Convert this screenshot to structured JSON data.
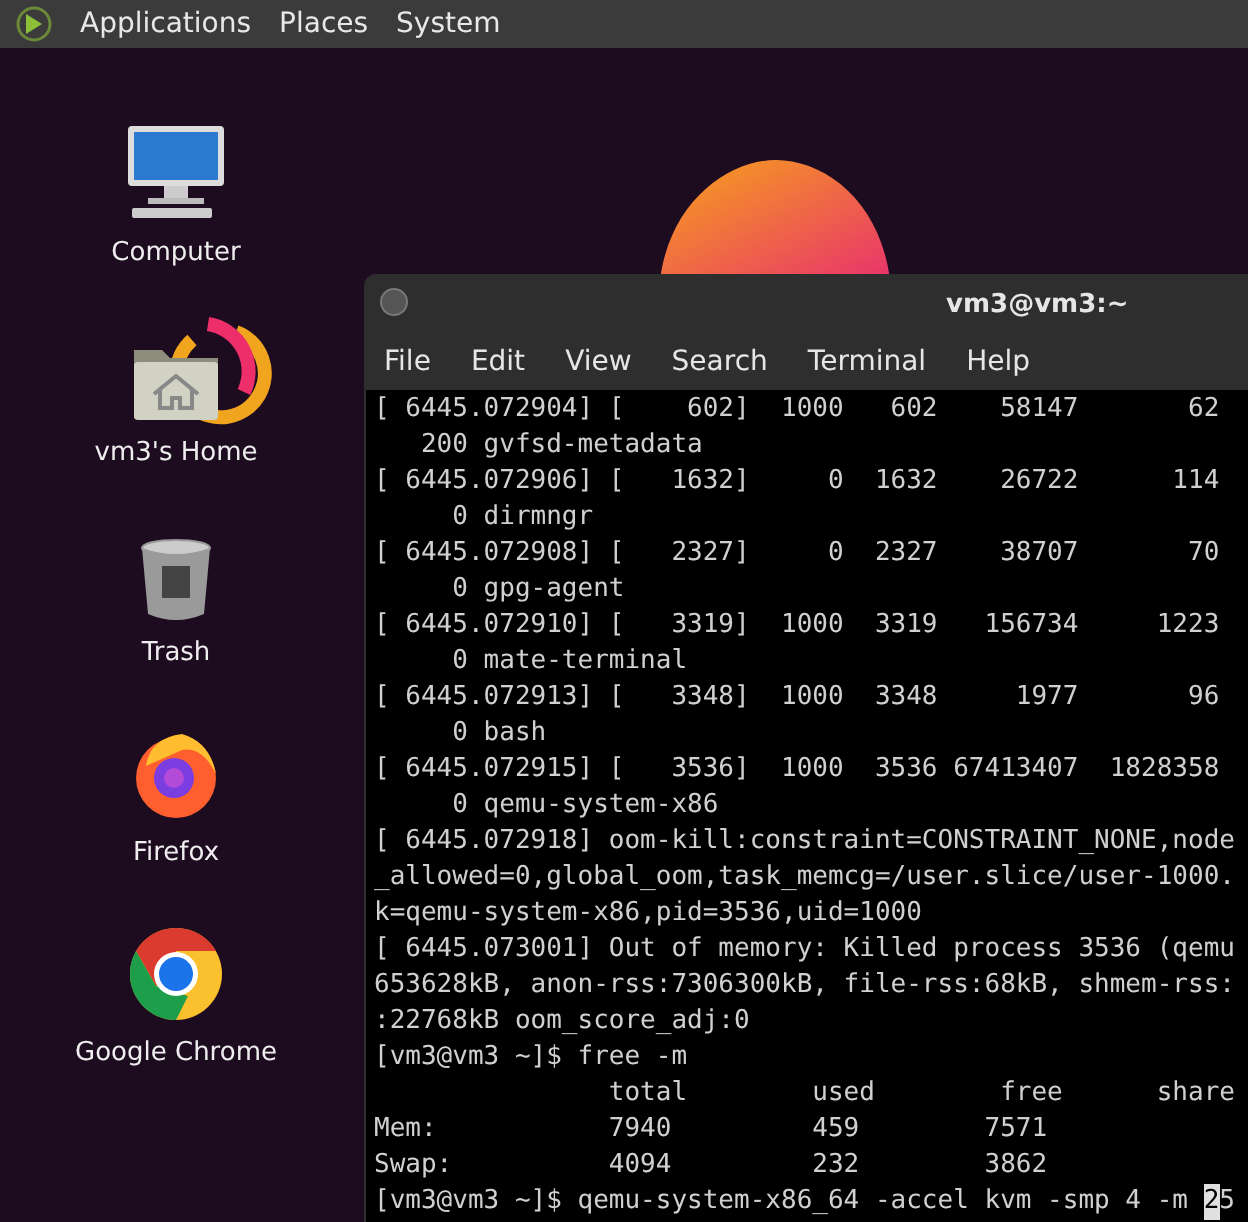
{
  "panel": {
    "menus": [
      "Applications",
      "Places",
      "System"
    ]
  },
  "desktop_icons": [
    {
      "kind": "computer",
      "label": "Computer"
    },
    {
      "kind": "home",
      "label": "vm3's Home"
    },
    {
      "kind": "trash",
      "label": "Trash"
    },
    {
      "kind": "firefox",
      "label": "Firefox"
    },
    {
      "kind": "chrome",
      "label": "Google Chrome"
    }
  ],
  "terminal": {
    "title": "vm3@vm3:~",
    "menu": [
      "File",
      "Edit",
      "View",
      "Search",
      "Terminal",
      "Help"
    ],
    "lines": [
      "[ 6445.072904] [    602]  1000   602    58147       62",
      "   200 gvfsd-metadata",
      "[ 6445.072906] [   1632]     0  1632    26722      114",
      "     0 dirmngr",
      "[ 6445.072908] [   2327]     0  2327    38707       70",
      "     0 gpg-agent",
      "[ 6445.072910] [   3319]  1000  3319   156734     1223",
      "     0 mate-terminal",
      "[ 6445.072913] [   3348]  1000  3348     1977       96",
      "     0 bash",
      "[ 6445.072915] [   3536]  1000  3536 67413407  1828358",
      "     0 qemu-system-x86",
      "[ 6445.072918] oom-kill:constraint=CONSTRAINT_NONE,node",
      "_allowed=0,global_oom,task_memcg=/user.slice/user-1000.",
      "k=qemu-system-x86,pid=3536,uid=1000",
      "[ 6445.073001] Out of memory: Killed process 3536 (qemu",
      "653628kB, anon-rss:7306300kB, file-rss:68kB, shmem-rss:",
      ":22768kB oom_score_adj:0",
      "[vm3@vm3 ~]$ free -m",
      "               total        used        free      share",
      "Mem:           7940         459        7571",
      "Swap:          4094         232        3862"
    ],
    "prompt": {
      "before": "[vm3@vm3 ~]$ qemu-system-x86_64 -accel kvm -smp 4 -m ",
      "cursor": "2",
      "after": "5"
    }
  }
}
